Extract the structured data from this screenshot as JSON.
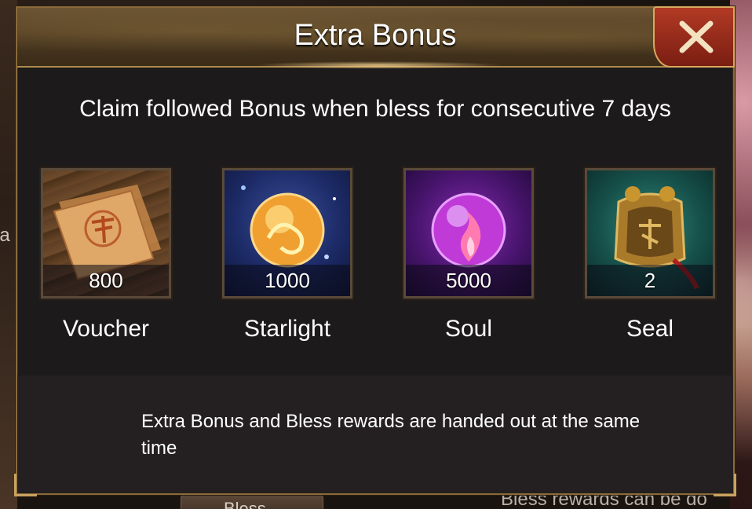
{
  "dialog": {
    "title": "Extra Bonus",
    "instruction": "Claim followed Bonus when bless for consecutive 7 days",
    "footer_note": "Extra Bonus and Bless rewards are handed out at the same time"
  },
  "rewards": [
    {
      "name": "Voucher",
      "count": "800",
      "icon": "voucher-scroll-icon"
    },
    {
      "name": "Starlight",
      "count": "1000",
      "icon": "starlight-orb-icon"
    },
    {
      "name": "Soul",
      "count": "5000",
      "icon": "soul-orb-icon"
    },
    {
      "name": "Seal",
      "count": "2",
      "icon": "seal-token-icon"
    }
  ],
  "background": {
    "left_text": "la",
    "bottom_tab_label": "Bless",
    "bottom_text": "Bless rewards can be do"
  },
  "colors": {
    "dialog_border": "#8a6a3a",
    "close_button": "#b23a24",
    "text": "#ffffff"
  }
}
